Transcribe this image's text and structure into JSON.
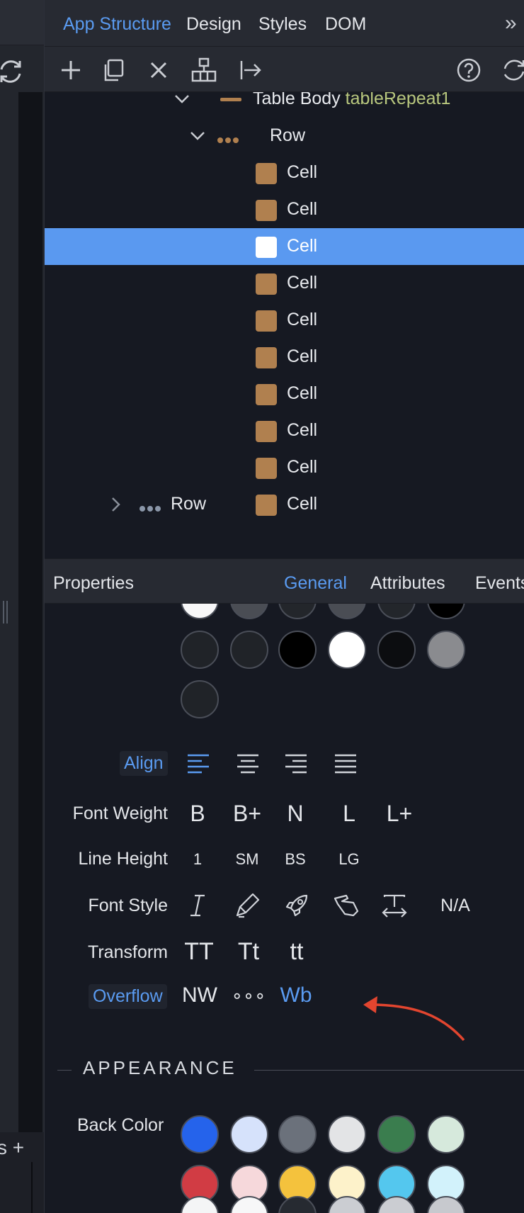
{
  "tabs": [
    "App Structure",
    "Design",
    "Styles",
    "DOM"
  ],
  "active_tab": "App Structure",
  "more_label": "»",
  "left": {
    "bottom_text": "s +"
  },
  "tree": {
    "table_body": {
      "label": "Table Body",
      "id": "tableRepeat1"
    },
    "row_label": "Row",
    "cell_label": "Cell",
    "cell_count": 10,
    "selected_index": 2,
    "collapsed_row_label": "Row"
  },
  "properties": {
    "title": "Properties",
    "tabs": [
      "General",
      "Attributes",
      "Events"
    ],
    "active_tab": "General"
  },
  "text_colors_row1": [
    "#f7f7f8",
    "#4a4d54",
    "#23262b",
    "#4a4d54",
    "#23262b",
    "#000000"
  ],
  "text_colors_row2": [
    "#202328",
    "#202328",
    "#000000",
    "#ffffff",
    "#0c0d10",
    "#8a8b8f"
  ],
  "text_colors_row3": [
    "#202328"
  ],
  "align": {
    "label": "Align"
  },
  "font_weight": {
    "label": "Font Weight",
    "options": [
      "B",
      "B+",
      "N",
      "L",
      "L+"
    ]
  },
  "line_height": {
    "label": "Line Height",
    "options": [
      "1",
      "SM",
      "BS",
      "LG"
    ]
  },
  "font_style": {
    "label": "Font Style",
    "na": "N/A"
  },
  "transform": {
    "label": "Transform",
    "options": [
      "TT",
      "Tt",
      "tt"
    ]
  },
  "overflow": {
    "label": "Overflow",
    "options": [
      "NW",
      "∘∘∘",
      "Wb"
    ],
    "active": "Wb"
  },
  "appearance": {
    "title": "APPEARANCE",
    "back_color_label": "Back Color",
    "row1": [
      "#2563eb",
      "#d6e2fb",
      "#6b717b",
      "#e3e4e6",
      "#3a7d4e",
      "#d6e9dc"
    ],
    "row2": [
      "#d13c44",
      "#f6d8db",
      "#f4c23d",
      "#fdf2ca",
      "#54c7ee",
      "#d2f2fb"
    ],
    "row3": [
      "#f4f5f6",
      "#f7f7f8",
      "#262a31",
      "#cbcdd2",
      "#cbcdd2",
      "#c7c9ce"
    ]
  },
  "accent_color": "#5a9bf1",
  "annotation_color": "#e2452f"
}
